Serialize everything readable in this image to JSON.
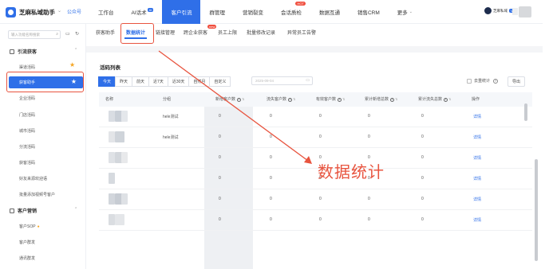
{
  "app": {
    "name": "芝麻私域助手",
    "public_account": "公众号"
  },
  "nav": [
    {
      "label": "工作台"
    },
    {
      "label": "AI话术",
      "badge": "AI"
    },
    {
      "label": "客户引流",
      "active": true
    },
    {
      "label": "群管理"
    },
    {
      "label": "营销裂变"
    },
    {
      "label": "会话质检",
      "badge": "HOT"
    },
    {
      "label": "数据互通"
    },
    {
      "label": "销售CRM"
    },
    {
      "label": "更多"
    }
  ],
  "user": {
    "name": "芝麻私域",
    "tag": "VIP"
  },
  "sidebar": {
    "search_placeholder": "输入功能名称搜索",
    "group1": "引流获客",
    "items": [
      "渠道活码",
      "获客助手",
      "企业活码",
      "门店活码",
      "城市活码",
      "分流活码",
      "获客活码",
      "好友来源欢迎语",
      "批量添加视频号客户"
    ],
    "group2": "客户营销",
    "items2": [
      "客户SOP",
      "客户群发",
      "通讯群发"
    ]
  },
  "subtabs": [
    "获客助手",
    "数据统计",
    "链接管理",
    "跨企业获客",
    "员工上限",
    "批量修改记录",
    "异常员工告警"
  ],
  "subtab_new_badge": "new",
  "panel": {
    "title": "活码列表",
    "date_tabs": [
      "今天",
      "昨天",
      "前天",
      "近7天",
      "近30天",
      "自然月",
      "自定义"
    ],
    "date_placeholder": "2025-09-04",
    "toggle_label": "去重统计",
    "export_label": "导出"
  },
  "table": {
    "headers": [
      "名称",
      "分组",
      "新增客户数",
      "流失客户数",
      "有效客户数",
      "累计新增总数",
      "累计流失总数",
      "操作"
    ],
    "rows": [
      {
        "group": "hele测试",
        "v": [
          "0",
          "0",
          "0",
          "0",
          "0"
        ],
        "action": "详情"
      },
      {
        "group": "hele测试",
        "v": [
          "0",
          "0",
          "0",
          "0",
          "0"
        ],
        "action": "详情"
      },
      {
        "group": "",
        "v": [
          "0",
          "0",
          "0",
          "0",
          "0"
        ],
        "action": "详情"
      },
      {
        "group": "",
        "v": [
          "0",
          "0",
          "0",
          "0",
          "0"
        ],
        "action": "详情"
      },
      {
        "group": "",
        "v": [
          "0",
          "0",
          "0",
          "0",
          "0"
        ],
        "action": "详情"
      },
      {
        "group": "",
        "v": [
          "0",
          "0",
          "0",
          "0",
          "0"
        ],
        "action": "详情"
      }
    ]
  },
  "annotation": {
    "label": "数据统计",
    "color": "#e8543f"
  }
}
